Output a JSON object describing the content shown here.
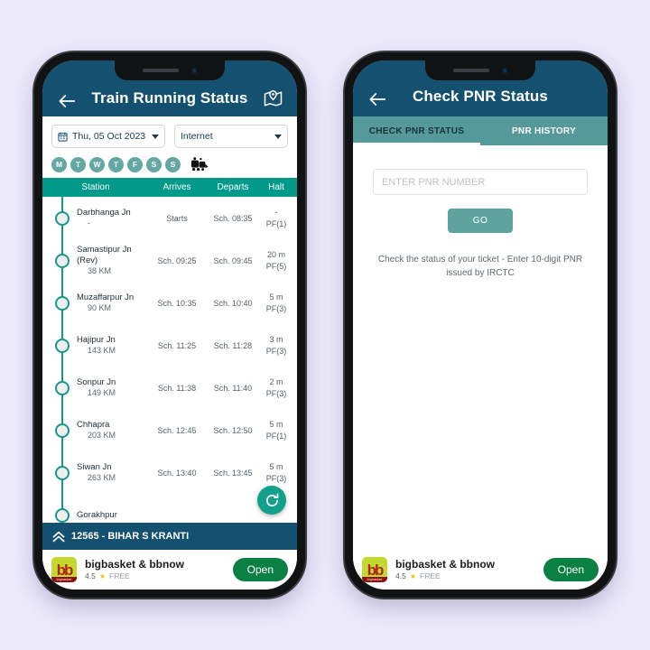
{
  "theme": {
    "page_bg": "#ece9fb",
    "navy": "#14506f",
    "teal_header": "#00998a",
    "tab_bar": "#56999a",
    "accent_green": "#12a08c",
    "day_chip": "#63a8a3"
  },
  "left_phone": {
    "appbar": {
      "back_icon": "back-arrow-icon",
      "title": "Train Running Status",
      "trailing_icon": "map-location-icon"
    },
    "filters": {
      "date": {
        "icon": "calendar-icon",
        "value": "Thu, 05 Oct 2023"
      },
      "source": {
        "value": "Internet"
      }
    },
    "days": [
      "M",
      "T",
      "W",
      "T",
      "F",
      "S",
      "S"
    ],
    "days_trailing_icon": "train-coach-icon",
    "table": {
      "headers": [
        "Station",
        "Arrives",
        "Departs",
        "Halt"
      ],
      "rows": [
        {
          "name": "Darbhanga Jn",
          "km": "-",
          "arrives": "Starts",
          "departs": "Sch. 08:35",
          "halt": "-",
          "pf": "PF(1)"
        },
        {
          "name": "Samastipur Jn (Rev)",
          "km": "38 KM",
          "arrives": "Sch. 09:25",
          "departs": "Sch. 09:45",
          "halt": "20 m",
          "pf": "PF(5)"
        },
        {
          "name": "Muzaffarpur Jn",
          "km": "90 KM",
          "arrives": "Sch. 10:35",
          "departs": "Sch. 10:40",
          "halt": "5 m",
          "pf": "PF(3)"
        },
        {
          "name": "Hajipur Jn",
          "km": "143 KM",
          "arrives": "Sch. 11:25",
          "departs": "Sch. 11:28",
          "halt": "3 m",
          "pf": "PF(3)"
        },
        {
          "name": "Sonpur Jn",
          "km": "149 KM",
          "arrives": "Sch. 11:38",
          "departs": "Sch. 11:40",
          "halt": "2 m",
          "pf": "PF(3)"
        },
        {
          "name": "Chhapra",
          "km": "203 KM",
          "arrives": "Sch. 12:45",
          "departs": "Sch. 12:50",
          "halt": "5 m",
          "pf": "PF(1)"
        },
        {
          "name": "Siwan Jn",
          "km": "263 KM",
          "arrives": "Sch. 13:40",
          "departs": "Sch. 13:45",
          "halt": "5 m",
          "pf": "PF(3)"
        },
        {
          "name": "Gorakhpur",
          "km": "",
          "arrives": "",
          "departs": "",
          "halt": "",
          "pf": ""
        }
      ]
    },
    "refresh_icon": "refresh-icon",
    "train_bar": {
      "icon": "chevron-double-up-icon",
      "label": "12565 - BIHAR S KRANTI"
    }
  },
  "right_phone": {
    "appbar": {
      "back_icon": "back-arrow-icon",
      "title": "Check PNR Status"
    },
    "tabs": [
      {
        "label": "CHECK PNR STATUS",
        "active": true
      },
      {
        "label": "PNR HISTORY",
        "active": false
      }
    ],
    "pnr_input": {
      "placeholder": "ENTER PNR NUMBER",
      "value": ""
    },
    "go_button": "GO",
    "hint": "Check the status of your ticket - Enter 10-digit PNR issued by IRCTC"
  },
  "ad": {
    "icon_text": "bb",
    "icon_footer": "bigbasket",
    "title": "bigbasket & bbnow",
    "rating": "4.5",
    "star": "★",
    "price": "FREE",
    "cta": "Open"
  }
}
